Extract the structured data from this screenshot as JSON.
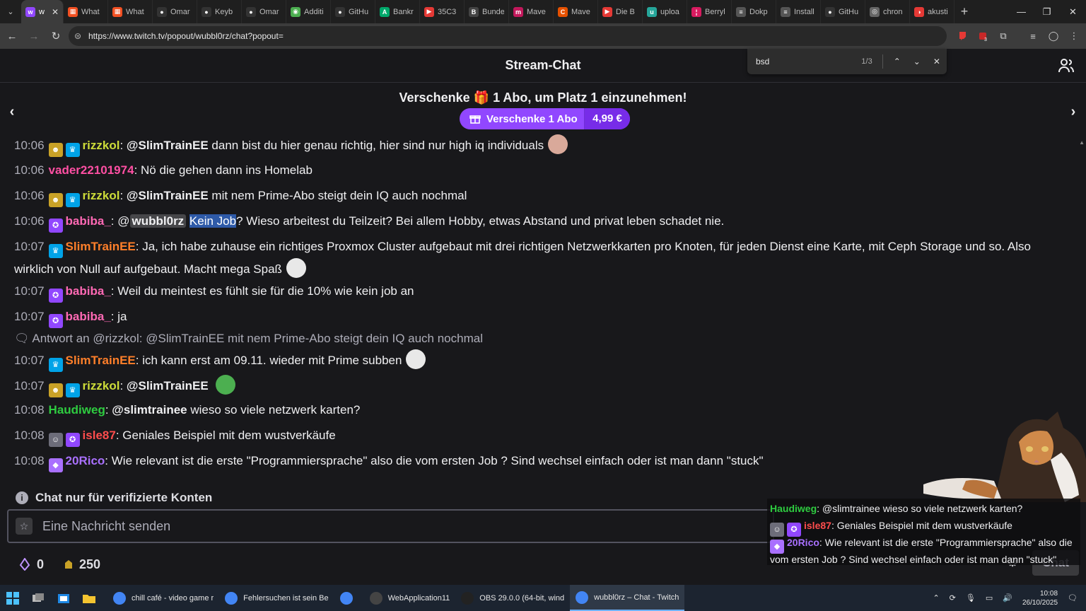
{
  "browser": {
    "tabs": [
      {
        "title": "w",
        "color": "#9147ff",
        "glyph": "w",
        "active": true
      },
      {
        "title": "What",
        "color": "#f25022",
        "glyph": "▦"
      },
      {
        "title": "What",
        "color": "#f25022",
        "glyph": "▦"
      },
      {
        "title": "Omar",
        "color": "#333333",
        "glyph": "●"
      },
      {
        "title": "Keyb",
        "color": "#333333",
        "glyph": "●"
      },
      {
        "title": "Omar",
        "color": "#333333",
        "glyph": "●"
      },
      {
        "title": "Additi",
        "color": "#4caf50",
        "glyph": "◉"
      },
      {
        "title": "GitHu",
        "color": "#333333",
        "glyph": "●"
      },
      {
        "title": "Bankr",
        "color": "#00a86b",
        "glyph": "A"
      },
      {
        "title": "35C3",
        "color": "#e53935",
        "glyph": "▶"
      },
      {
        "title": "Bunde",
        "color": "#444444",
        "glyph": "B"
      },
      {
        "title": "Mave",
        "color": "#c2185b",
        "glyph": "m"
      },
      {
        "title": "Mave",
        "color": "#e65100",
        "glyph": "C"
      },
      {
        "title": "Die B",
        "color": "#e53935",
        "glyph": "▶"
      },
      {
        "title": "uploa",
        "color": "#26a69a",
        "glyph": "u"
      },
      {
        "title": "Berryl",
        "color": "#d81b60",
        "glyph": "¦"
      },
      {
        "title": "Dokp",
        "color": "#555555",
        "glyph": "≡"
      },
      {
        "title": "Install",
        "color": "#555555",
        "glyph": "≡"
      },
      {
        "title": "GitHu",
        "color": "#333333",
        "glyph": "●"
      },
      {
        "title": "chron",
        "color": "#666666",
        "glyph": "◎"
      },
      {
        "title": "akusti",
        "color": "#e53935",
        "glyph": "◑"
      }
    ],
    "url": "https://www.twitch.tv/popout/wubbl0rz/chat?popout=",
    "find": {
      "query": "bsd",
      "count": "1/3"
    }
  },
  "chat": {
    "header_title": "Stream-Chat",
    "gift": {
      "headline_pre": "Verschenke",
      "headline_icon": "🎁",
      "headline_num": "1",
      "headline_post": "Abo, um Platz 1 einzunehmen!",
      "button_label": "Verschenke 1 Abo",
      "price": "4,99 €"
    },
    "messages": [
      {
        "time": "10:06",
        "badges": [
          "bits",
          "prime"
        ],
        "user": "rizzkol",
        "color": "#cddc39",
        "mention": "@SlimTrainEE",
        "text": "dann bist du hier genau richtig, hier sind nur high iq individuals",
        "emote": "#d9a99a"
      },
      {
        "time": "10:06",
        "badges": [],
        "user": "vader22101974",
        "color": "#ff4fa3",
        "text": "Nö die gehen dann ins Homelab"
      },
      {
        "time": "10:06",
        "badges": [
          "bits",
          "prime"
        ],
        "user": "rizzkol",
        "color": "#cddc39",
        "mention": "@SlimTrainEE",
        "text": "mit nem Prime-Abo steigt dein IQ auch nochmal"
      },
      {
        "time": "10:06",
        "badges": [
          "sub"
        ],
        "user": "babiba_",
        "color": "#ff69b4",
        "at": "@",
        "mention_box": "wubbl0rz",
        "highlight": "Kein Job",
        "text": "? Wieso arbeitest du Teilzeit? Bei allem Hobby, etwas Abstand und privat leben schadet nie."
      },
      {
        "time": "10:07",
        "badges": [
          "prime"
        ],
        "user": "SlimTrainEE",
        "color": "#ff7f2a",
        "text": "Ja, ich habe zuhause ein richtiges Proxmox Cluster aufgebaut mit drei richtigen Netzwerkkarten pro Knoten, für jeden Dienst eine Karte, mit Ceph Storage und so. Also wirklich von Null auf aufgebaut. Macht mega Spaß",
        "emote": "#e8e8e8"
      },
      {
        "time": "10:07",
        "badges": [
          "sub"
        ],
        "user": "babiba_",
        "color": "#ff69b4",
        "text": "Weil du meintest es fühlt sie für die 10% wie kein job an"
      },
      {
        "time": "10:07",
        "badges": [
          "sub"
        ],
        "user": "babiba_",
        "color": "#ff69b4",
        "text": "ja"
      },
      {
        "time": "10:07",
        "badges": [
          "prime"
        ],
        "user": "SlimTrainEE",
        "color": "#ff7f2a",
        "text": "ich kann erst am 09.11. wieder mit Prime subben",
        "emote": "#e8e8e8",
        "reply": "Antwort an @rizzkol: @SlimTrainEE mit nem Prime-Abo steigt dein IQ auch nochmal"
      },
      {
        "time": "10:07",
        "badges": [
          "bits",
          "prime"
        ],
        "user": "rizzkol",
        "color": "#cddc39",
        "mention": "@SlimTrainEE",
        "text": "",
        "emote": "#4caf50"
      },
      {
        "time": "10:08",
        "badges": [],
        "user": "Haudiweg",
        "color": "#2ecc40",
        "mention": "@slimtrainee",
        "text": "wieso so viele netzwerk karten?"
      },
      {
        "time": "10:08",
        "badges": [
          "glitch",
          "sub"
        ],
        "user": "isle87",
        "color": "#ff4d4d",
        "text": "Geniales Beispiel mit dem wustverkäufe"
      },
      {
        "time": "10:08",
        "badges": [
          "vip"
        ],
        "user": "20Rico",
        "color": "#a970ff",
        "text": "Wie relevant ist die erste \"Programmiersprache\" also die vom ersten Job ? Sind wechsel einfach oder ist man dann \"stuck\""
      }
    ],
    "verified_notice": "Chat nur für verifizierte Konten",
    "input_placeholder": "Eine Nachricht senden",
    "points": {
      "bits": "0",
      "channel_points": "250"
    },
    "chat_button_ghost": "Chat"
  },
  "overlay": {
    "lines": [
      {
        "user": "Haudiweg",
        "color": "#2ecc40",
        "text": "@slimtrainee wieso so viele netzwerk karten?"
      },
      {
        "user": "isle87",
        "color": "#ff4d4d",
        "text": "Geniales Beispiel mit dem wustverkäufe"
      },
      {
        "user": "20Rico",
        "color": "#a970ff",
        "text": "Wie relevant ist die erste \"Programmiersprache\" also die vom ersten Job ? Sind wechsel einfach oder ist man dann \"stuck\""
      }
    ]
  },
  "taskbar": {
    "apps": [
      {
        "label": "chill café - video game r",
        "color": "#4285f4",
        "active": false
      },
      {
        "label": "Fehlersuchen ist sein Be",
        "color": "#4285f4",
        "active": false
      },
      {
        "label": "",
        "color": "#4285f4",
        "active": false
      },
      {
        "label": "WebApplication11",
        "color": "#444444",
        "active": false
      },
      {
        "label": "OBS 29.0.0 (64-bit, wind",
        "color": "#222222",
        "active": false
      },
      {
        "label": "wubbl0rz – Chat - Twitch",
        "color": "#4285f4",
        "active": true
      }
    ],
    "time": "10:08",
    "date": "26/10/2025"
  }
}
